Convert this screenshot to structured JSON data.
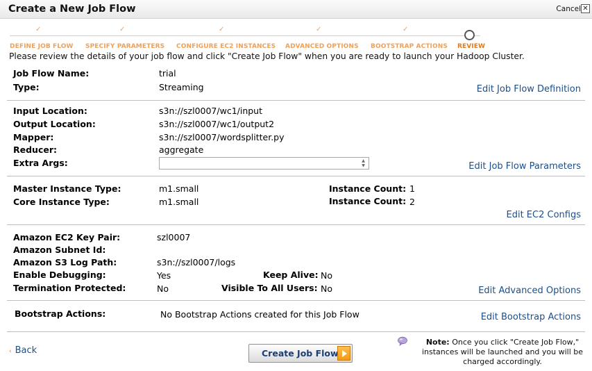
{
  "window": {
    "title": "Create a New Job Flow",
    "cancel_label": "Cancel",
    "close_glyph": "✕"
  },
  "wizard": {
    "check_glyph": "✓",
    "steps": [
      {
        "label": "DEFINE JOB FLOW"
      },
      {
        "label": "SPECIFY PARAMETERS"
      },
      {
        "label": "CONFIGURE EC2 INSTANCES"
      },
      {
        "label": "ADVANCED OPTIONS"
      },
      {
        "label": "BOOTSTRAP ACTIONS"
      },
      {
        "label": "REVIEW"
      }
    ]
  },
  "intro": "Please review the details of your job flow and click \"Create Job Flow\" when you are ready to launch your Hadoop Cluster.",
  "definition": {
    "name_label": "Job Flow Name:",
    "name_value": "trial",
    "type_label": "Type:",
    "type_value": "Streaming",
    "edit": "Edit Job Flow Definition"
  },
  "parameters": {
    "input_label": "Input Location:",
    "input_value": "s3n://szl0007/wc1/input",
    "output_label": "Output Location:",
    "output_value": "s3n://szl0007/wc1/output2",
    "mapper_label": "Mapper:",
    "mapper_value": "s3n://szl0007/wordsplitter.py",
    "reducer_label": "Reducer:",
    "reducer_value": "aggregate",
    "extra_label": "Extra Args:",
    "extra_value": "",
    "edit": "Edit Job Flow Parameters"
  },
  "ec2": {
    "master_label": "Master Instance Type:",
    "master_value": "m1.small",
    "master_count_label": "Instance Count:",
    "master_count_value": "1",
    "core_label": "Core Instance Type:",
    "core_value": "m1.small",
    "core_count_label": "Instance Count:",
    "core_count_value": "2",
    "edit": "Edit EC2 Configs"
  },
  "advanced": {
    "keypair_label": "Amazon EC2 Key Pair:",
    "keypair_value": "szl0007",
    "subnet_label": "Amazon Subnet Id:",
    "subnet_value": "",
    "logpath_label": "Amazon S3 Log Path:",
    "logpath_value": "s3n://szl0007/logs",
    "debug_label": "Enable Debugging:",
    "debug_value": "Yes",
    "keepalive_label": "Keep Alive:",
    "keepalive_value": "No",
    "termination_label": "Termination Protected:",
    "termination_value": "No",
    "visible_label": "Visible To All Users:",
    "visible_value": "No",
    "edit": "Edit Advanced Options"
  },
  "bootstrap": {
    "label": "Bootstrap Actions:",
    "value": "No Bootstrap Actions created for this Job Flow",
    "edit": "Edit Bootstrap Actions"
  },
  "footer": {
    "back_glyph": "‹",
    "back_label": "Back",
    "create_label": "Create Job Flow",
    "note_title": "Note:",
    "note_text": " Once you click \"Create Job Flow,\" instances will be launched and you will be charged accordingly."
  }
}
